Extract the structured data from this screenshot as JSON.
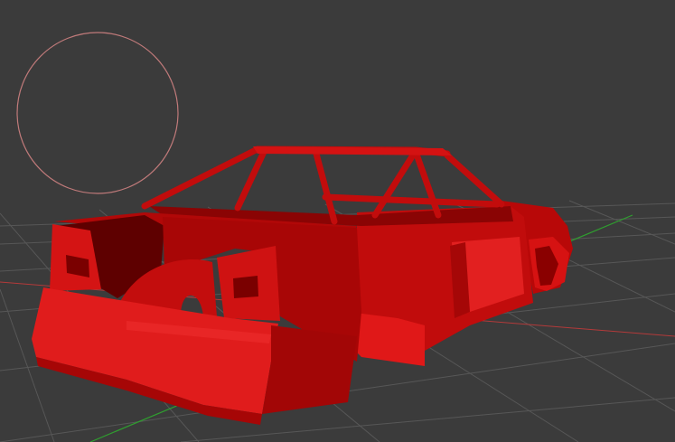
{
  "viewport": {
    "background_color": "#3b3b3b",
    "grid_color": "#5a5a5a",
    "axis_x_color": "#b33a3a",
    "axis_z_color": "#2f9e2f",
    "gizmo_circle_color": "#c07a7a",
    "model": {
      "name": "car-body",
      "base_color": "#d41010",
      "shade_dark": "#7a0000",
      "shade_mid": "#a80606",
      "shade_light": "#e82020"
    }
  }
}
